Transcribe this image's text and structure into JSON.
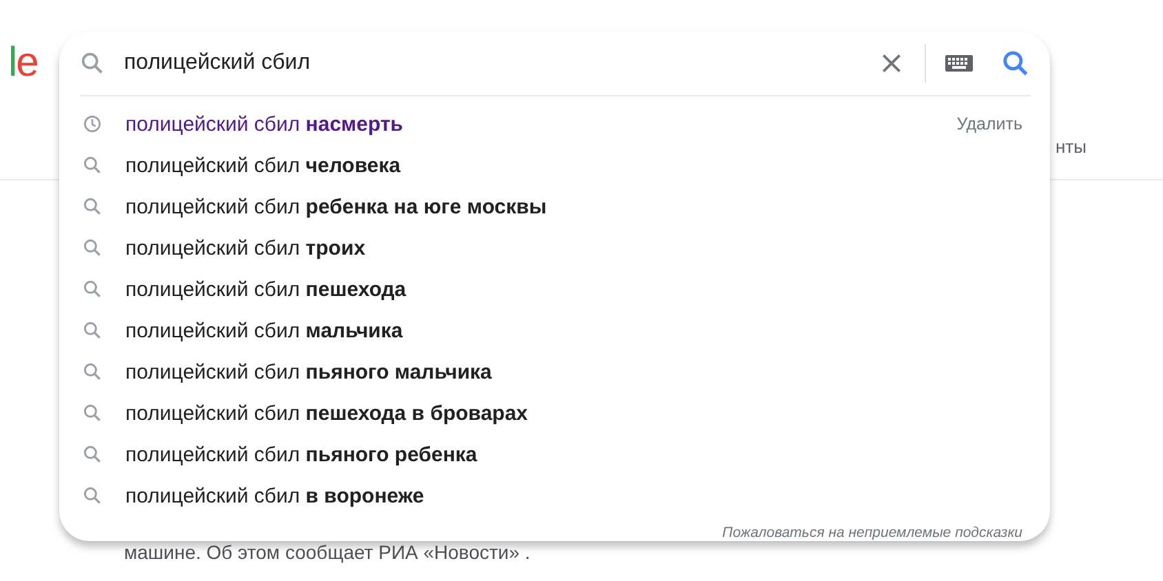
{
  "logo": {
    "letters": [
      {
        "char": "l",
        "color": "#34a853"
      },
      {
        "char": "e",
        "color": "#ea4335"
      }
    ]
  },
  "background": {
    "tab_fragment": "нты",
    "snippet": "машине. Об этом сообщает РИА «Новости» ."
  },
  "search": {
    "value": "полицейский сбил"
  },
  "suggestions": [
    {
      "kind": "history",
      "text": "полицейский сбил **насмерть**",
      "action": "Удалить"
    },
    {
      "kind": "suggestion",
      "text": "полицейский сбил **человека**"
    },
    {
      "kind": "suggestion",
      "text": "полицейский сбил **ребенка на юге москвы**"
    },
    {
      "kind": "suggestion",
      "text": "полицейский сбил **троих**"
    },
    {
      "kind": "suggestion",
      "text": "полицейский сбил **пешехода**"
    },
    {
      "kind": "suggestion",
      "text": "полицейский сбил **мальчика**"
    },
    {
      "kind": "suggestion",
      "text": "полицейский сбил **пьяного мальчика**"
    },
    {
      "kind": "suggestion",
      "text": "полицейский сбил **пешехода в броварах**"
    },
    {
      "kind": "suggestion",
      "text": "полицейский сбил **пьяного ребенка**"
    },
    {
      "kind": "suggestion",
      "text": "полицейский сбил **в воронеже**"
    }
  ],
  "report_link": "Пожаловаться на неприемлемые подсказки"
}
